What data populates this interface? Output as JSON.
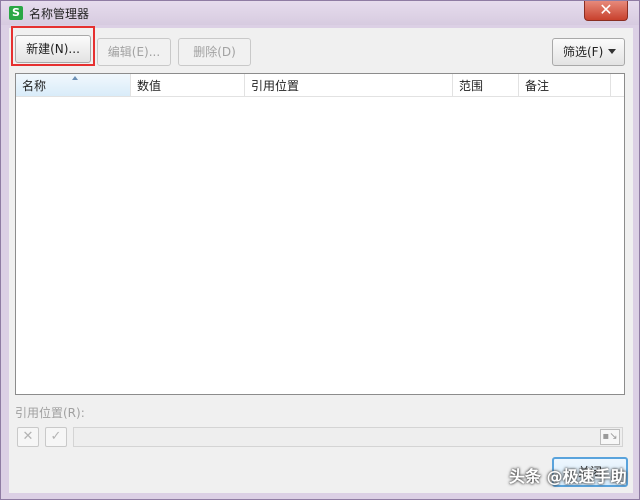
{
  "window": {
    "title": "名称管理器",
    "app_icon": "S",
    "close_glyph": "✕"
  },
  "toolbar": {
    "new_label": "新建(N)...",
    "edit_label": "编辑(E)...",
    "delete_label": "删除(D)",
    "filter_label": "筛选(F)"
  },
  "table": {
    "columns": [
      "名称",
      "数值",
      "引用位置",
      "范围",
      "备注"
    ],
    "rows": []
  },
  "reference": {
    "label": "引用位置(R):",
    "value": "",
    "cancel_glyph": "✕",
    "confirm_glyph": "✓"
  },
  "footer": {
    "close_label": "关闭"
  },
  "watermark": "头条 @极速手助",
  "colors": {
    "highlight": "#e63030",
    "app_icon": "#2aa745",
    "close_button": "#c8412d",
    "focus_border": "#59a3dc"
  }
}
